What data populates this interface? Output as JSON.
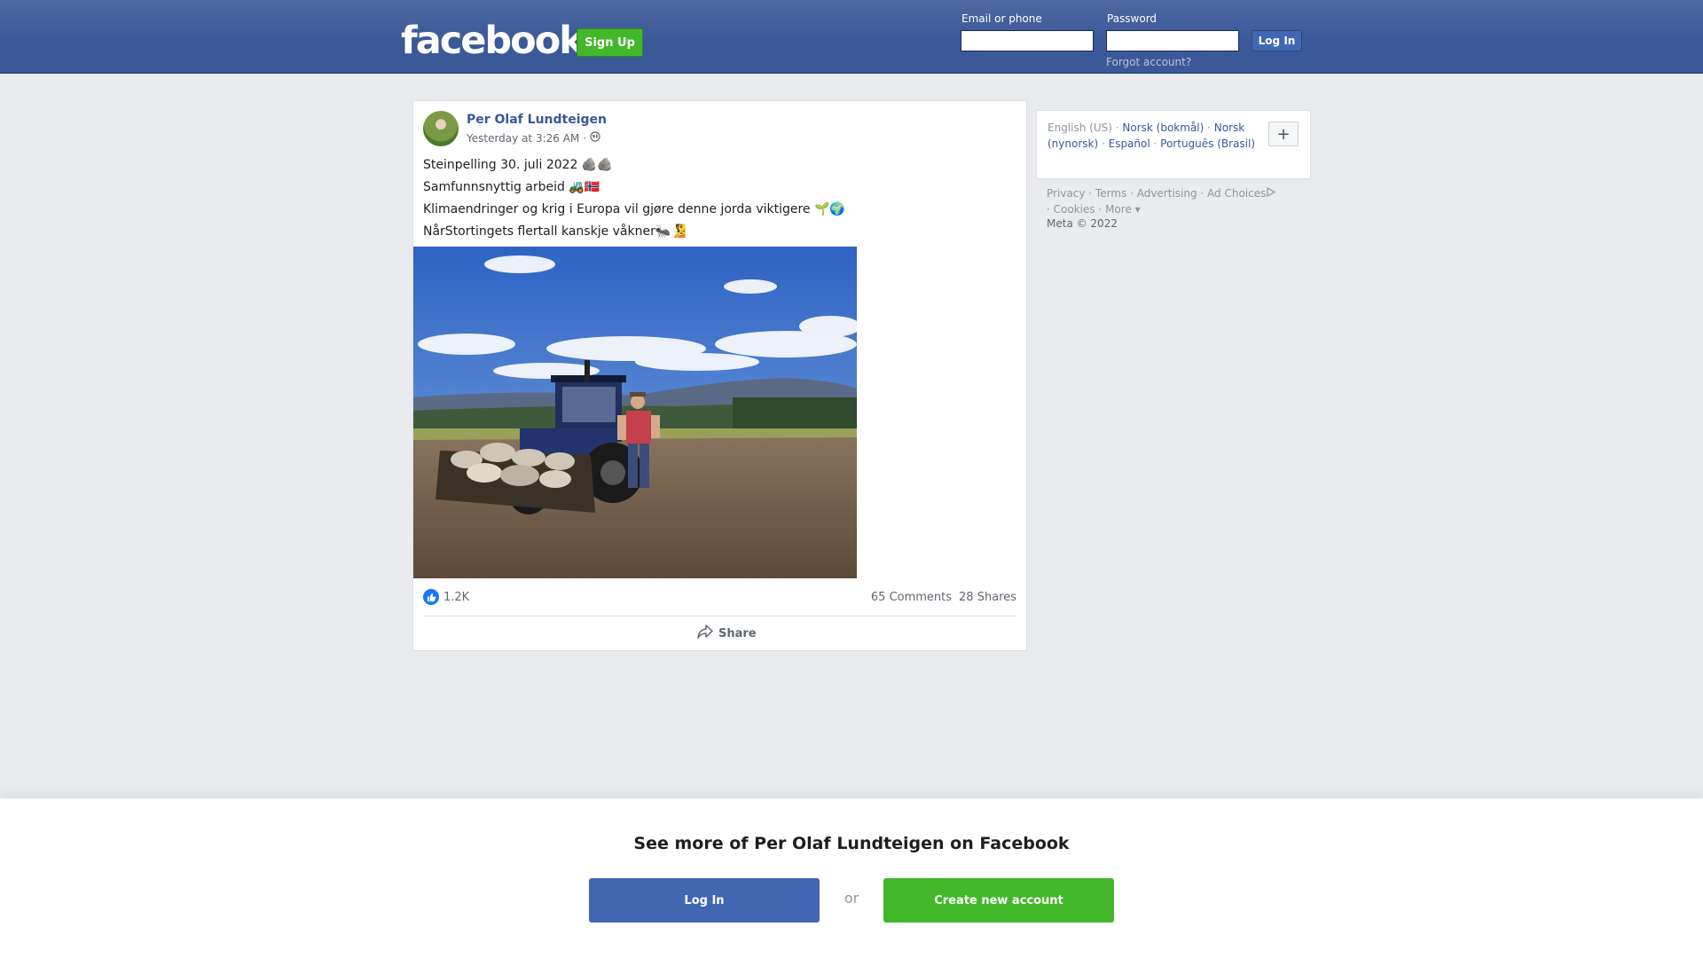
{
  "header": {
    "logo": "facebook",
    "signup_label": "Sign Up",
    "email_label": "Email or phone",
    "password_label": "Password",
    "login_label": "Log In",
    "forgot_label": "Forgot account?"
  },
  "post": {
    "author": "Per Olaf Lundteigen",
    "timestamp": "Yesterday at 3:26 AM",
    "separator": "·",
    "audience_icon": "globe-icon",
    "lines": [
      "Steinpelling 30. juli 2022 🪨🪨",
      "Samfunnsnyttig arbeid 🚜🇳🇴",
      "Klimaendringer og krig i Europa vil gjøre denne jorda viktigere 🌱🌍",
      "NårStortingets flertall kanskje våkner🐜🧏"
    ],
    "photo_description_icon": "photo-tractor-field",
    "like_count": "1.2K",
    "comments": "65 Comments",
    "shares": "28 Shares",
    "share_label": "Share"
  },
  "sidebar": {
    "current_language": "English (US)",
    "languages": [
      "Norsk (bokmål)",
      "Norsk (nynorsk)",
      "Español",
      "Português (Brasil)"
    ],
    "plus_label": "+",
    "footer_links": [
      "Privacy",
      "Terms",
      "Advertising",
      "Ad Choices",
      "Cookies",
      "More"
    ],
    "copyright": "Meta © 2022"
  },
  "banner": {
    "title": "See more of Per Olaf Lundteigen on Facebook",
    "login_label": "Log In",
    "or_label": "or",
    "create_label": "Create new account"
  },
  "colors": {
    "brand_blue": "#3b5998",
    "link_blue": "#385898",
    "button_blue": "#4267b2",
    "signup_green": "#42b72a",
    "page_bg": "#e9ebee"
  }
}
